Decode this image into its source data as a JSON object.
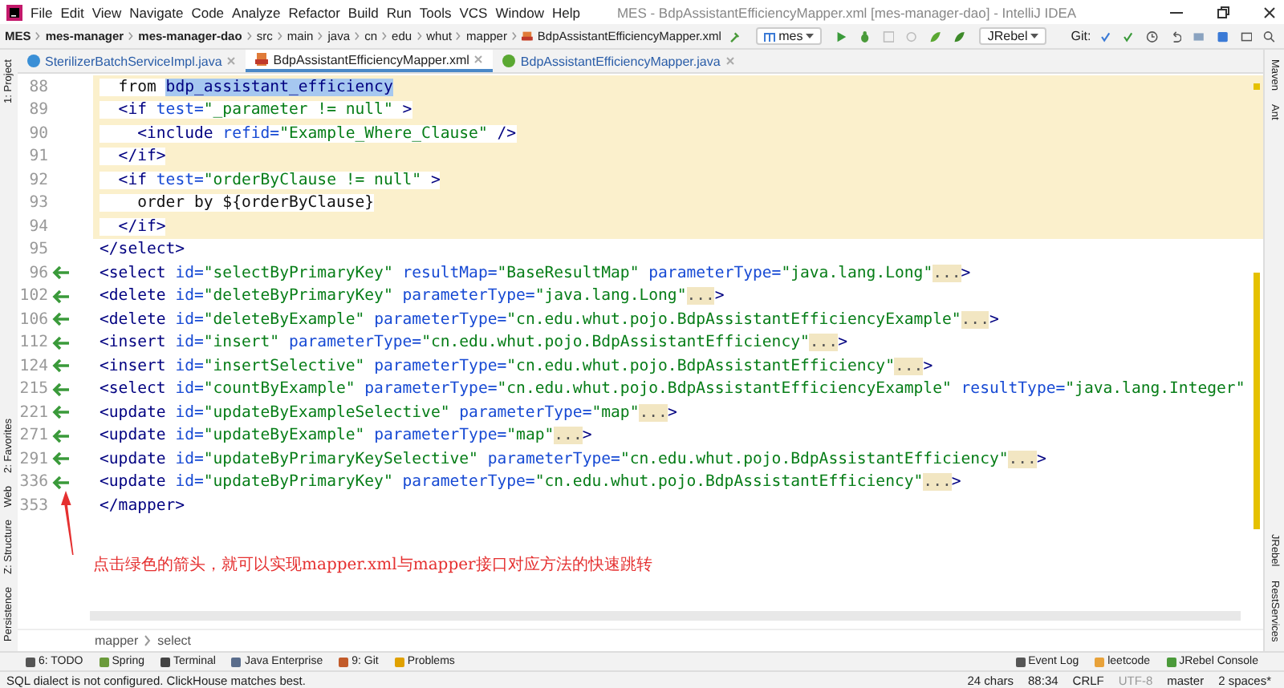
{
  "window": {
    "title": "MES - BdpAssistantEfficiencyMapper.xml [mes-manager-dao] - IntelliJ IDEA"
  },
  "menu": [
    "File",
    "Edit",
    "View",
    "Navigate",
    "Code",
    "Analyze",
    "Refactor",
    "Build",
    "Run",
    "Tools",
    "VCS",
    "Window",
    "Help"
  ],
  "nav_path": [
    {
      "label": "MES",
      "bold": true
    },
    {
      "label": "mes-manager",
      "bold": true
    },
    {
      "label": "mes-manager-dao",
      "bold": true
    },
    {
      "label": "src",
      "bold": false
    },
    {
      "label": "main",
      "bold": false
    },
    {
      "label": "java",
      "bold": false
    },
    {
      "label": "cn",
      "bold": false
    },
    {
      "label": "edu",
      "bold": false
    },
    {
      "label": "whut",
      "bold": false
    },
    {
      "label": "mapper",
      "bold": false
    },
    {
      "label": "BdpAssistantEfficiencyMapper.xml",
      "bold": false
    }
  ],
  "toolbar": {
    "run_config": "mes",
    "jrebel": "JRebel",
    "git_label": "Git:"
  },
  "tabs": [
    {
      "label": "SterilizerBatchServiceImpl.java",
      "kind": "java-class",
      "selected": false
    },
    {
      "label": "BdpAssistantEfficiencyMapper.xml",
      "kind": "xml",
      "selected": true
    },
    {
      "label": "BdpAssistantEfficiencyMapper.java",
      "kind": "java-interface",
      "selected": false
    }
  ],
  "left_stripe": {
    "top": [
      "1: Project"
    ],
    "bottom": [
      "2: Favorites",
      "Web",
      "Z: Structure",
      "Persistence"
    ]
  },
  "right_stripe": {
    "top": [
      "Maven",
      "Ant"
    ],
    "bottom": [
      "JRebel",
      "RestServices"
    ]
  },
  "code_lines": [
    {
      "number": "88",
      "navigable": false,
      "highlighted": true,
      "tokens": [
        {
          "kind": "text",
          "text": "  from "
        },
        {
          "kind": "sel",
          "text": "bdp_assistant_efficiency"
        }
      ]
    },
    {
      "number": "89",
      "navigable": false,
      "highlighted": true,
      "tokens": [
        {
          "kind": "tag",
          "text": "  <if"
        },
        {
          "kind": "attr",
          "text": " test="
        },
        {
          "kind": "str",
          "text": "\"_parameter != null\""
        },
        {
          "kind": "tag",
          "text": " >"
        }
      ]
    },
    {
      "number": "90",
      "navigable": false,
      "highlighted": true,
      "tokens": [
        {
          "kind": "tag",
          "text": "    <include"
        },
        {
          "kind": "attr",
          "text": " refid="
        },
        {
          "kind": "str",
          "text": "\"Example_Where_Clause\""
        },
        {
          "kind": "tag",
          "text": " />"
        }
      ]
    },
    {
      "number": "91",
      "navigable": false,
      "highlighted": true,
      "tokens": [
        {
          "kind": "tag",
          "text": "  </if>"
        }
      ]
    },
    {
      "number": "92",
      "navigable": false,
      "highlighted": true,
      "tokens": [
        {
          "kind": "tag",
          "text": "  <if"
        },
        {
          "kind": "attr",
          "text": " test="
        },
        {
          "kind": "str",
          "text": "\"orderByClause != null\""
        },
        {
          "kind": "tag",
          "text": " >"
        }
      ]
    },
    {
      "number": "93",
      "navigable": false,
      "highlighted": true,
      "tokens": [
        {
          "kind": "text",
          "text": "    order by ${orderByClause}"
        }
      ]
    },
    {
      "number": "94",
      "navigable": false,
      "highlighted": true,
      "tokens": [
        {
          "kind": "tag",
          "text": "  </if>"
        }
      ]
    },
    {
      "number": "95",
      "navigable": false,
      "highlighted": false,
      "tokens": [
        {
          "kind": "tag",
          "text": "</select>"
        }
      ]
    },
    {
      "number": "96",
      "navigable": true,
      "highlighted": false,
      "tokens": [
        {
          "kind": "tag",
          "text": "<select"
        },
        {
          "kind": "attr",
          "text": " id="
        },
        {
          "kind": "str",
          "text": "\"selectByPrimaryKey\""
        },
        {
          "kind": "attr",
          "text": " resultMap="
        },
        {
          "kind": "str",
          "text": "\"BaseResultMap\""
        },
        {
          "kind": "attr",
          "text": " parameterType="
        },
        {
          "kind": "str",
          "text": "\"java.lang.Long\""
        },
        {
          "kind": "fold",
          "text": "..."
        },
        {
          "kind": "tag",
          "text": ">"
        }
      ]
    },
    {
      "number": "102",
      "navigable": true,
      "highlighted": false,
      "tokens": [
        {
          "kind": "tag",
          "text": "<delete"
        },
        {
          "kind": "attr",
          "text": " id="
        },
        {
          "kind": "str",
          "text": "\"deleteByPrimaryKey\""
        },
        {
          "kind": "attr",
          "text": " parameterType="
        },
        {
          "kind": "str",
          "text": "\"java.lang.Long\""
        },
        {
          "kind": "fold",
          "text": "..."
        },
        {
          "kind": "tag",
          "text": ">"
        }
      ]
    },
    {
      "number": "106",
      "navigable": true,
      "highlighted": false,
      "tokens": [
        {
          "kind": "tag",
          "text": "<delete"
        },
        {
          "kind": "attr",
          "text": " id="
        },
        {
          "kind": "str",
          "text": "\"deleteByExample\""
        },
        {
          "kind": "attr",
          "text": " parameterType="
        },
        {
          "kind": "str",
          "text": "\"cn.edu.whut.pojo.BdpAssistantEfficiencyExample\""
        },
        {
          "kind": "fold",
          "text": "..."
        },
        {
          "kind": "tag",
          "text": ">"
        }
      ]
    },
    {
      "number": "112",
      "navigable": true,
      "highlighted": false,
      "tokens": [
        {
          "kind": "tag",
          "text": "<insert"
        },
        {
          "kind": "attr",
          "text": " id="
        },
        {
          "kind": "str",
          "text": "\"insert\""
        },
        {
          "kind": "attr",
          "text": " parameterType="
        },
        {
          "kind": "str",
          "text": "\"cn.edu.whut.pojo.BdpAssistantEfficiency\""
        },
        {
          "kind": "fold",
          "text": "..."
        },
        {
          "kind": "tag",
          "text": ">"
        }
      ]
    },
    {
      "number": "124",
      "navigable": true,
      "highlighted": false,
      "tokens": [
        {
          "kind": "tag",
          "text": "<insert"
        },
        {
          "kind": "attr",
          "text": " id="
        },
        {
          "kind": "str",
          "text": "\"insertSelective\""
        },
        {
          "kind": "attr",
          "text": " parameterType="
        },
        {
          "kind": "str",
          "text": "\"cn.edu.whut.pojo.BdpAssistantEfficiency\""
        },
        {
          "kind": "fold",
          "text": "..."
        },
        {
          "kind": "tag",
          "text": ">"
        }
      ]
    },
    {
      "number": "215",
      "navigable": true,
      "highlighted": false,
      "tokens": [
        {
          "kind": "tag",
          "text": "<select"
        },
        {
          "kind": "attr",
          "text": " id="
        },
        {
          "kind": "str",
          "text": "\"countByExample\""
        },
        {
          "kind": "attr",
          "text": " parameterType="
        },
        {
          "kind": "str",
          "text": "\"cn.edu.whut.pojo.BdpAssistantEfficiencyExample\""
        },
        {
          "kind": "attr",
          "text": " resultType="
        },
        {
          "kind": "str",
          "text": "\"java.lang.Integer\""
        }
      ]
    },
    {
      "number": "221",
      "navigable": true,
      "highlighted": false,
      "tokens": [
        {
          "kind": "tag",
          "text": "<update"
        },
        {
          "kind": "attr",
          "text": " id="
        },
        {
          "kind": "str",
          "text": "\"updateByExampleSelective\""
        },
        {
          "kind": "attr",
          "text": " parameterType="
        },
        {
          "kind": "str",
          "text": "\"map\""
        },
        {
          "kind": "fold",
          "text": "..."
        },
        {
          "kind": "tag",
          "text": ">"
        }
      ]
    },
    {
      "number": "271",
      "navigable": true,
      "highlighted": false,
      "tokens": [
        {
          "kind": "tag",
          "text": "<update"
        },
        {
          "kind": "attr",
          "text": " id="
        },
        {
          "kind": "str",
          "text": "\"updateByExample\""
        },
        {
          "kind": "attr",
          "text": " parameterType="
        },
        {
          "kind": "str",
          "text": "\"map\""
        },
        {
          "kind": "fold",
          "text": "..."
        },
        {
          "kind": "tag",
          "text": ">"
        }
      ]
    },
    {
      "number": "291",
      "navigable": true,
      "highlighted": false,
      "tokens": [
        {
          "kind": "tag",
          "text": "<update"
        },
        {
          "kind": "attr",
          "text": " id="
        },
        {
          "kind": "str",
          "text": "\"updateByPrimaryKeySelective\""
        },
        {
          "kind": "attr",
          "text": " parameterType="
        },
        {
          "kind": "str",
          "text": "\"cn.edu.whut.pojo.BdpAssistantEfficiency\""
        },
        {
          "kind": "fold",
          "text": "..."
        },
        {
          "kind": "tag",
          "text": ">"
        }
      ]
    },
    {
      "number": "336",
      "navigable": true,
      "highlighted": false,
      "tokens": [
        {
          "kind": "tag",
          "text": "<update"
        },
        {
          "kind": "attr",
          "text": " id="
        },
        {
          "kind": "str",
          "text": "\"updateByPrimaryKey\""
        },
        {
          "kind": "attr",
          "text": " parameterType="
        },
        {
          "kind": "str",
          "text": "\"cn.edu.whut.pojo.BdpAssistantEfficiency\""
        },
        {
          "kind": "fold",
          "text": "..."
        },
        {
          "kind": "tag",
          "text": ">"
        }
      ]
    },
    {
      "number": "353",
      "navigable": false,
      "highlighted": false,
      "tokens": [
        {
          "kind": "tag",
          "text": "</mapper>"
        }
      ]
    }
  ],
  "annotation": "点击绿色的箭头，就可以实现mapper.xml与mapper接口对应方法的快速跳转",
  "editor_breadcrumb": [
    "mapper",
    "select"
  ],
  "tool_windows": {
    "left": [
      {
        "label": "6: TODO",
        "kind": "todo"
      },
      {
        "label": "Spring",
        "kind": "spring"
      },
      {
        "label": "Terminal",
        "kind": "terminal"
      },
      {
        "label": "Java Enterprise",
        "kind": "enterprise"
      },
      {
        "label": "9: Git",
        "kind": "git"
      },
      {
        "label": "Problems",
        "kind": "problems"
      }
    ],
    "right": [
      {
        "label": "Event Log",
        "kind": "log"
      },
      {
        "label": "leetcode",
        "kind": "leetcode"
      },
      {
        "label": "JRebel Console",
        "kind": "jrebel"
      }
    ]
  },
  "status_bar": {
    "message": "SQL dialect is not configured. ClickHouse matches best.",
    "selection": "24 chars",
    "position": "88:34",
    "line_sep": "CRLF",
    "encoding": "UTF-8",
    "branch": "master",
    "indent": "2 spaces*"
  }
}
